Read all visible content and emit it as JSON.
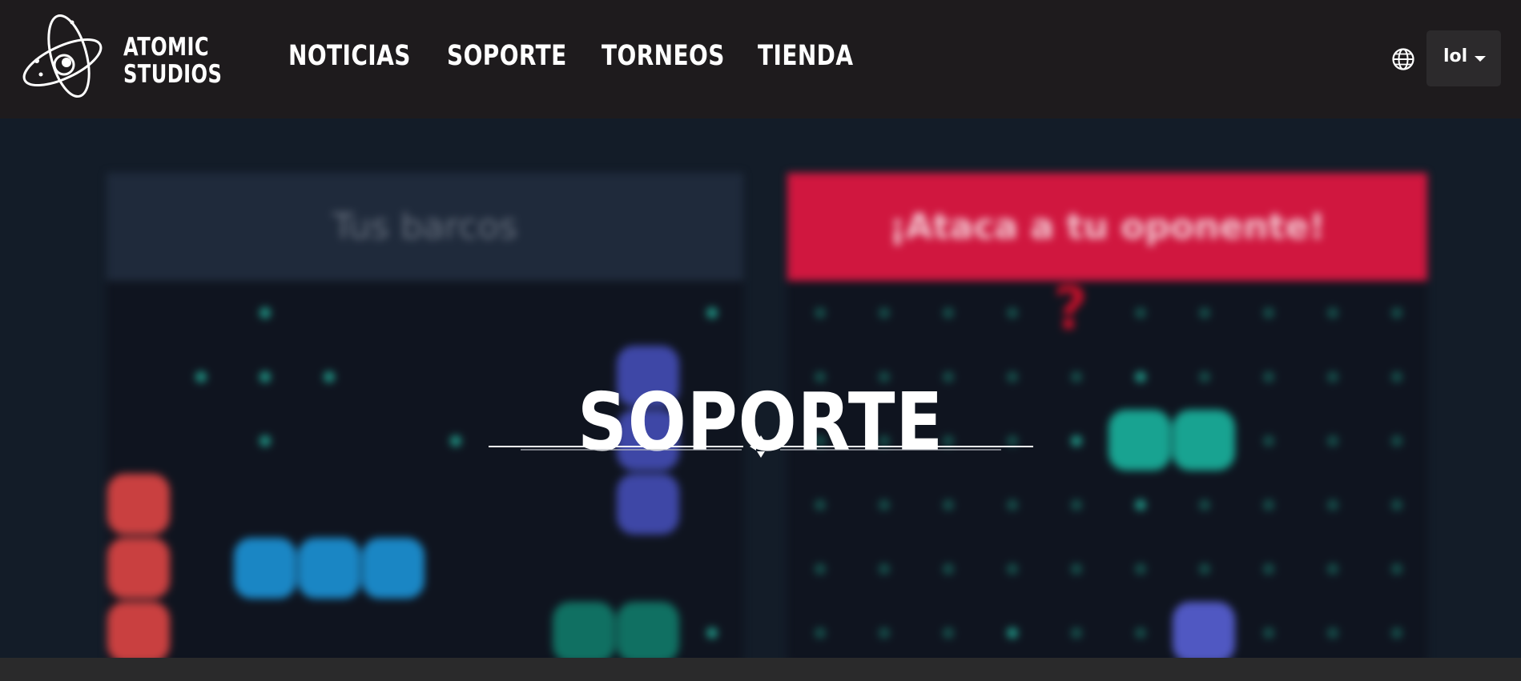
{
  "brand": {
    "name_line1": "ATOMIC",
    "name_line2": "STUDIOS",
    "icon": "atom-logo-icon"
  },
  "nav": {
    "items": [
      {
        "label": "NOTICIAS"
      },
      {
        "label": "SOPORTE"
      },
      {
        "label": "TORNEOS"
      },
      {
        "label": "TIENDA"
      }
    ]
  },
  "language": {
    "icon": "globe-icon",
    "selected": "lol"
  },
  "hero": {
    "title": "SOPORTE",
    "background": {
      "left_header": "Tus barcos",
      "right_header": "¡Ataca a tu oponente!",
      "question_mark": "?"
    },
    "divider_icon": "ornament-cross-icon"
  },
  "colors": {
    "navbar_bg": "#1e1b1d",
    "hero_bg": "#131c28",
    "attack_red": "#d0173f",
    "teal": "#1e9c8c",
    "ship_red": "#c94040",
    "ship_blue": "#1a86c4",
    "ship_indigo": "#3e47a6",
    "ship_teal": "#107062"
  }
}
